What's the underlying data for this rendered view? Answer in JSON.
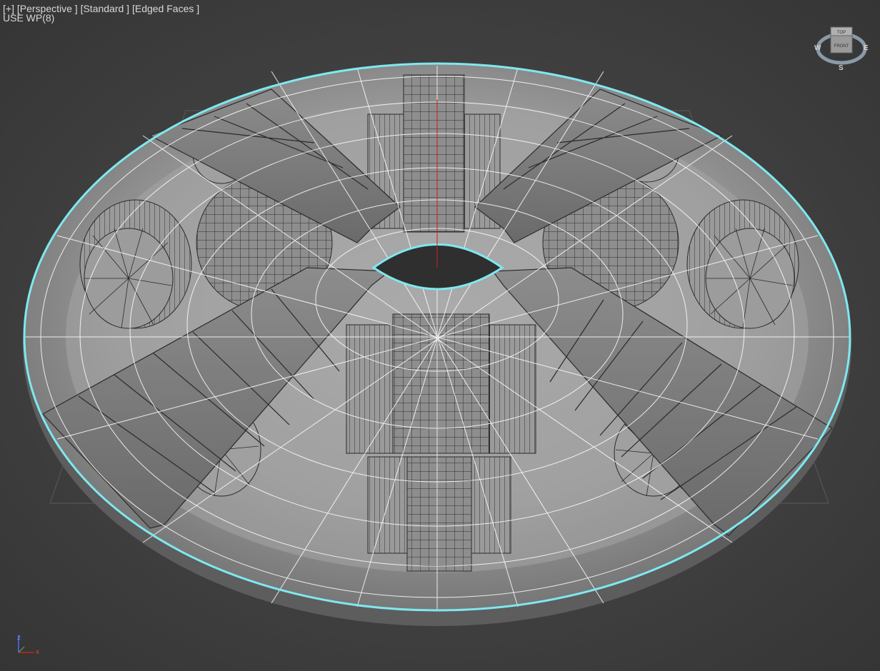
{
  "viewport": {
    "menu_plus": "[+]",
    "view_type": "[Perspective ]",
    "shading_mode": "[Standard ]",
    "display_mode": "[Edged Faces ]",
    "workplane_status": "USE WP(8)"
  },
  "viewcube": {
    "top_face": "TOP",
    "front_face": "FRONT",
    "compass_w": "W",
    "compass_e": "E",
    "compass_s": "S"
  },
  "axis_tripod": {
    "z_label": "z",
    "x_label": "x"
  },
  "colors": {
    "background": "#404040",
    "selection_outline": "#7fe8f0",
    "wire_white": "#ffffff",
    "mesh_grey": "#8a8a8a",
    "grid_line": "#5a5a5a",
    "axis_red": "#cc2020"
  },
  "scene": {
    "object": "torus-station-mesh",
    "selected": true
  }
}
